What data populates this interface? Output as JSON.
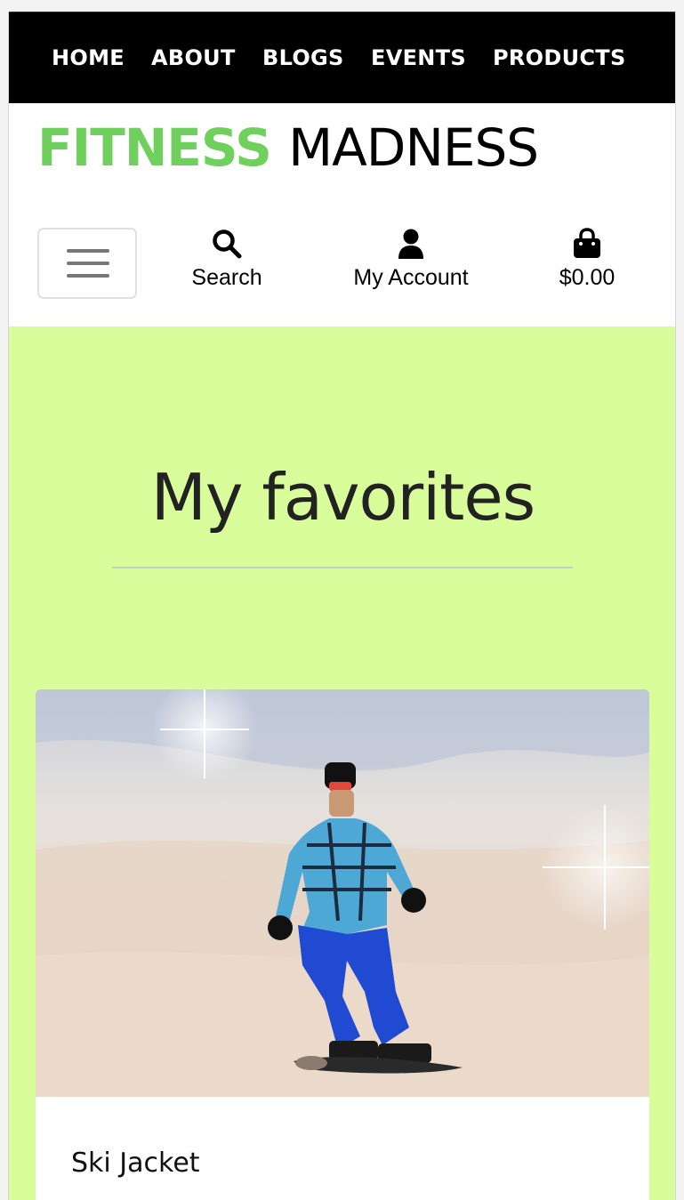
{
  "nav": {
    "items": [
      {
        "label": "HOME"
      },
      {
        "label": "ABOUT"
      },
      {
        "label": "BLOGS"
      },
      {
        "label": "EVENTS"
      },
      {
        "label": "PRODUCTS"
      }
    ]
  },
  "brand": {
    "part1": "FITNESS",
    "part2": "MADNESS",
    "accent_color": "#6fd05d"
  },
  "toolbar": {
    "menu_icon": "hamburger-icon",
    "search": {
      "label": "Search",
      "icon": "search-icon"
    },
    "account": {
      "label": "My Account",
      "icon": "user-icon"
    },
    "cart": {
      "label": "$0.00",
      "icon": "shopping-bag-icon"
    }
  },
  "page": {
    "title": "My favorites",
    "background": "#d9fd9a"
  },
  "favorites": [
    {
      "name": "Ski Jacket",
      "image": "snowboarder-photo"
    }
  ]
}
